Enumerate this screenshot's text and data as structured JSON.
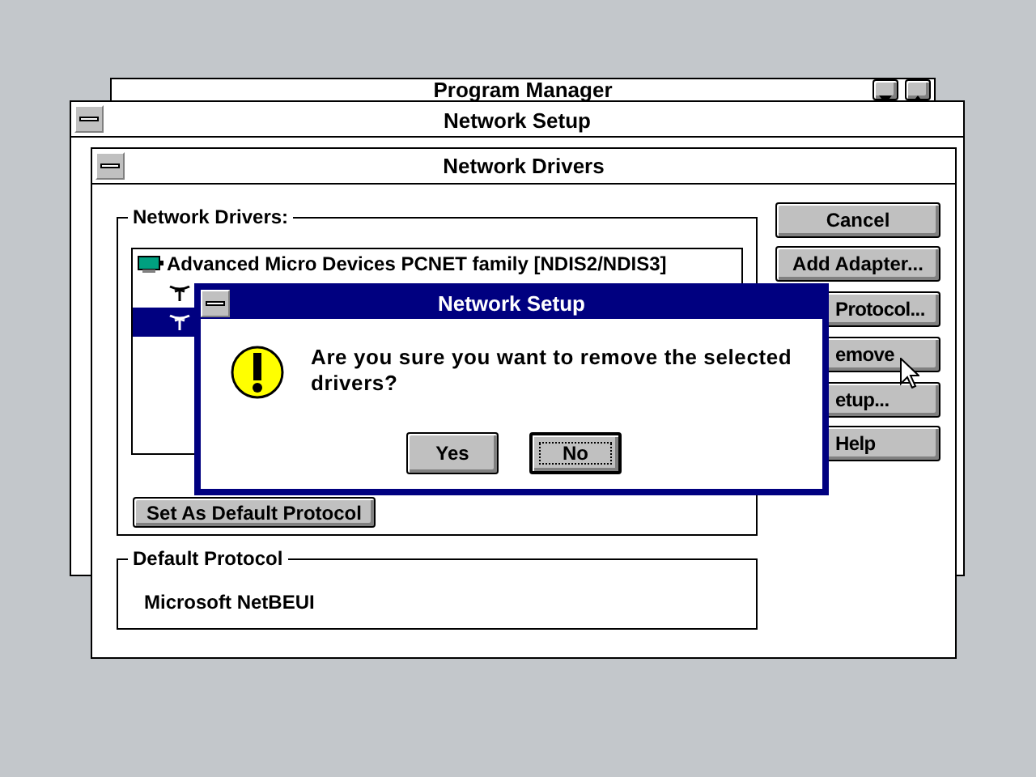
{
  "background_window": {
    "title": "Program Manager"
  },
  "setup_window": {
    "title": "Network Setup"
  },
  "drivers_window": {
    "title": "Network Drivers",
    "drivers_group": {
      "label": "Network Drivers:",
      "items": [
        {
          "kind": "adapter",
          "label": "Advanced Micro Devices PCNET family [NDIS2/NDIS3]",
          "selected": false
        },
        {
          "kind": "protocol",
          "selected": false
        },
        {
          "kind": "protocol",
          "selected": true
        }
      ],
      "default_button": "Set As Default Protocol"
    },
    "buttons": [
      {
        "label": "Cancel"
      },
      {
        "label": "Add Adapter..."
      },
      {
        "label": "Protocol..."
      },
      {
        "label": "emove"
      },
      {
        "label": "etup..."
      },
      {
        "label": "Help"
      }
    ],
    "default_protocol": {
      "label": "Default Protocol",
      "value": "Microsoft NetBEUI"
    }
  },
  "dialog": {
    "title": "Network Setup",
    "message": "Are you sure you want to remove the selected drivers?",
    "buttons": [
      {
        "label": "Yes",
        "default": false
      },
      {
        "label": "No",
        "default": true
      }
    ]
  }
}
